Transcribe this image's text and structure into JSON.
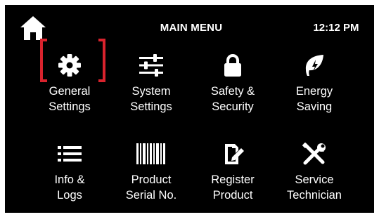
{
  "header": {
    "title": "MAIN MENU",
    "time": "12:12 PM",
    "home_icon": "home-icon"
  },
  "colors": {
    "background": "#000000",
    "text": "#ffffff",
    "selection": "#d9232d"
  },
  "menu": {
    "selected": "general-settings",
    "items": [
      {
        "id": "general-settings",
        "label": "General\nSettings",
        "icon": "gear-icon"
      },
      {
        "id": "system-settings",
        "label": "System\nSettings",
        "icon": "sliders-icon"
      },
      {
        "id": "safety-security",
        "label": "Safety &\nSecurity",
        "icon": "lock-icon"
      },
      {
        "id": "energy-saving",
        "label": "Energy\nSaving",
        "icon": "leaf-icon"
      },
      {
        "id": "info-logs",
        "label": "Info &\nLogs",
        "icon": "list-icon"
      },
      {
        "id": "product-serial",
        "label": "Product\nSerial No.",
        "icon": "barcode-icon"
      },
      {
        "id": "register-product",
        "label": "Register\nProduct",
        "icon": "register-icon"
      },
      {
        "id": "service-technician",
        "label": "Service\nTechnician",
        "icon": "tools-icon"
      }
    ]
  }
}
